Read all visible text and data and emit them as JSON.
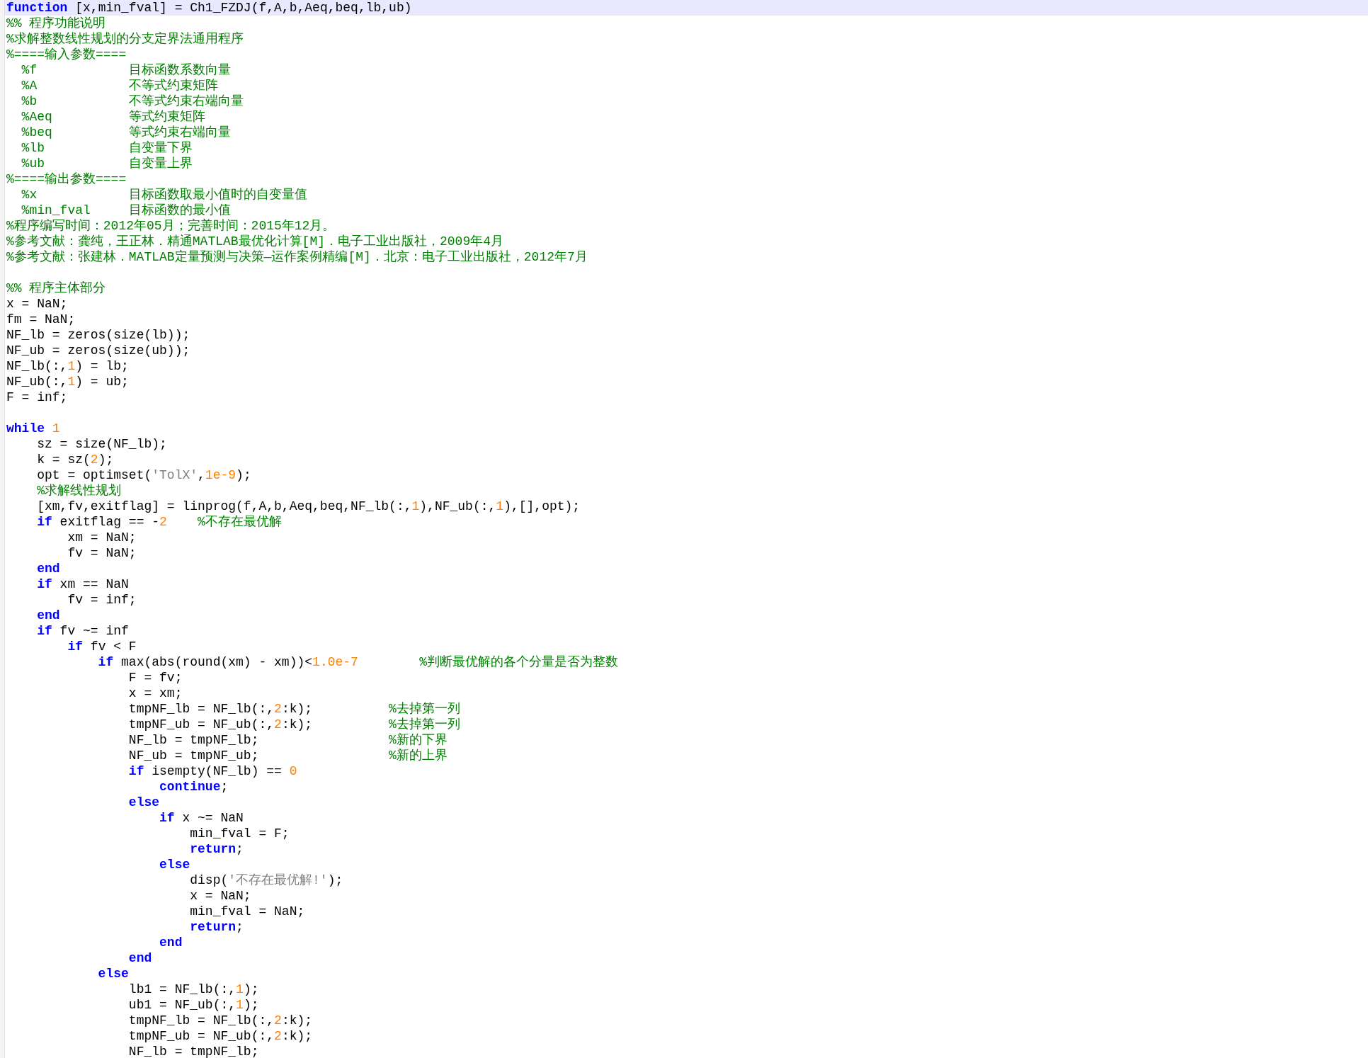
{
  "editor": {
    "lines": [
      {
        "current": true,
        "tokens": [
          {
            "kind": "keyword",
            "text": "function"
          },
          {
            "kind": "plain",
            "text": " [x,min_fval] = Ch1_FZDJ(f,A,b,Aeq,beq,lb,ub)"
          }
        ]
      },
      {
        "current": false,
        "tokens": [
          {
            "kind": "comment",
            "text": "%% 程序功能说明"
          }
        ]
      },
      {
        "current": false,
        "tokens": [
          {
            "kind": "comment",
            "text": "%求解整数线性规划的分支定界法通用程序"
          }
        ]
      },
      {
        "current": false,
        "tokens": [
          {
            "kind": "comment",
            "text": "%====输入参数===="
          }
        ]
      },
      {
        "current": false,
        "tokens": [
          {
            "kind": "comment",
            "text": "  %f            目标函数系数向量"
          }
        ]
      },
      {
        "current": false,
        "tokens": [
          {
            "kind": "comment",
            "text": "  %A            不等式约束矩阵"
          }
        ]
      },
      {
        "current": false,
        "tokens": [
          {
            "kind": "comment",
            "text": "  %b            不等式约束右端向量"
          }
        ]
      },
      {
        "current": false,
        "tokens": [
          {
            "kind": "comment",
            "text": "  %Aeq          等式约束矩阵"
          }
        ]
      },
      {
        "current": false,
        "tokens": [
          {
            "kind": "comment",
            "text": "  %beq          等式约束右端向量"
          }
        ]
      },
      {
        "current": false,
        "tokens": [
          {
            "kind": "comment",
            "text": "  %lb           自变量下界"
          }
        ]
      },
      {
        "current": false,
        "tokens": [
          {
            "kind": "comment",
            "text": "  %ub           自变量上界"
          }
        ]
      },
      {
        "current": false,
        "tokens": [
          {
            "kind": "comment",
            "text": "%====输出参数===="
          }
        ]
      },
      {
        "current": false,
        "tokens": [
          {
            "kind": "comment",
            "text": "  %x            目标函数取最小值时的自变量值"
          }
        ]
      },
      {
        "current": false,
        "tokens": [
          {
            "kind": "comment",
            "text": "  %min_fval     目标函数的最小值"
          }
        ]
      },
      {
        "current": false,
        "tokens": [
          {
            "kind": "comment",
            "text": "%程序编写时间：2012年05月；完善时间：2015年12月。"
          }
        ]
      },
      {
        "current": false,
        "tokens": [
          {
            "kind": "comment",
            "text": "%参考文献：龚纯，王正林．精通MATLAB最优化计算[M]．电子工业出版社，2009年4月"
          }
        ]
      },
      {
        "current": false,
        "tokens": [
          {
            "kind": "comment",
            "text": "%参考文献：张建林．MATLAB定量预测与决策—运作案例精编[M]．北京：电子工业出版社，2012年7月"
          }
        ]
      },
      {
        "current": false
      },
      {
        "current": false,
        "tokens": [
          {
            "kind": "comment",
            "text": "%% 程序主体部分"
          }
        ]
      },
      {
        "current": false,
        "tokens": [
          {
            "kind": "plain",
            "text": "x = NaN;"
          }
        ]
      },
      {
        "current": false,
        "tokens": [
          {
            "kind": "plain",
            "text": "fm = NaN;"
          }
        ]
      },
      {
        "current": false,
        "tokens": [
          {
            "kind": "plain",
            "text": "NF_lb = zeros(size(lb));"
          }
        ]
      },
      {
        "current": false,
        "tokens": [
          {
            "kind": "plain",
            "text": "NF_ub = zeros(size(ub));"
          }
        ]
      },
      {
        "current": false,
        "tokens": [
          {
            "kind": "plain",
            "text": "NF_lb(:,"
          },
          {
            "kind": "number",
            "text": "1"
          },
          {
            "kind": "plain",
            "text": ") = lb;"
          }
        ]
      },
      {
        "current": false,
        "tokens": [
          {
            "kind": "plain",
            "text": "NF_ub(:,"
          },
          {
            "kind": "number",
            "text": "1"
          },
          {
            "kind": "plain",
            "text": ") = ub;"
          }
        ]
      },
      {
        "current": false,
        "tokens": [
          {
            "kind": "plain",
            "text": "F = inf;"
          }
        ]
      },
      {
        "current": false
      },
      {
        "current": false,
        "tokens": [
          {
            "kind": "keyword",
            "text": "while"
          },
          {
            "kind": "number",
            "text": " 1"
          }
        ]
      },
      {
        "current": false,
        "tokens": [
          {
            "kind": "plain",
            "text": "    sz = size(NF_lb);"
          }
        ]
      },
      {
        "current": false,
        "tokens": [
          {
            "kind": "plain",
            "text": "    k = sz("
          },
          {
            "kind": "number",
            "text": "2"
          },
          {
            "kind": "plain",
            "text": ");"
          }
        ]
      },
      {
        "current": false,
        "tokens": [
          {
            "kind": "plain",
            "text": "    opt = optimset("
          },
          {
            "kind": "string",
            "text": "'TolX'"
          },
          {
            "kind": "plain",
            "text": ","
          },
          {
            "kind": "number",
            "text": "1e-9"
          },
          {
            "kind": "plain",
            "text": ");"
          }
        ]
      },
      {
        "current": false,
        "tokens": [
          {
            "kind": "comment",
            "text": "    %求解线性规划"
          }
        ]
      },
      {
        "current": false,
        "tokens": [
          {
            "kind": "plain",
            "text": "    [xm,fv,exitflag] = linprog(f,A,b,Aeq,beq,NF_lb(:,"
          },
          {
            "kind": "number",
            "text": "1"
          },
          {
            "kind": "plain",
            "text": "),NF_ub(:,"
          },
          {
            "kind": "number",
            "text": "1"
          },
          {
            "kind": "plain",
            "text": "),[],opt);"
          }
        ]
      },
      {
        "current": false,
        "tokens": [
          {
            "kind": "keyword",
            "text": "    if"
          },
          {
            "kind": "plain",
            "text": " exitflag == -"
          },
          {
            "kind": "number",
            "text": "2"
          },
          {
            "kind": "comment",
            "text": "    %不存在最优解"
          }
        ]
      },
      {
        "current": false,
        "tokens": [
          {
            "kind": "plain",
            "text": "        xm = NaN;"
          }
        ]
      },
      {
        "current": false,
        "tokens": [
          {
            "kind": "plain",
            "text": "        fv = NaN;"
          }
        ]
      },
      {
        "current": false,
        "tokens": [
          {
            "kind": "keyword",
            "text": "    end"
          }
        ]
      },
      {
        "current": false,
        "tokens": [
          {
            "kind": "keyword",
            "text": "    if"
          },
          {
            "kind": "plain",
            "text": " xm == NaN"
          }
        ]
      },
      {
        "current": false,
        "tokens": [
          {
            "kind": "plain",
            "text": "        fv = inf;"
          }
        ]
      },
      {
        "current": false,
        "tokens": [
          {
            "kind": "keyword",
            "text": "    end"
          }
        ]
      },
      {
        "current": false,
        "tokens": [
          {
            "kind": "keyword",
            "text": "    if"
          },
          {
            "kind": "plain",
            "text": " fv ~= inf"
          }
        ]
      },
      {
        "current": false,
        "tokens": [
          {
            "kind": "keyword",
            "text": "        if"
          },
          {
            "kind": "plain",
            "text": " fv < F"
          }
        ]
      },
      {
        "current": false,
        "tokens": [
          {
            "kind": "keyword",
            "text": "            if"
          },
          {
            "kind": "plain",
            "text": " max(abs(round(xm) - xm))<"
          },
          {
            "kind": "number",
            "text": "1.0e-7"
          },
          {
            "kind": "comment",
            "text": "        %判断最优解的各个分量是否为整数"
          }
        ]
      },
      {
        "current": false,
        "tokens": [
          {
            "kind": "plain",
            "text": "                F = fv;"
          }
        ]
      },
      {
        "current": false,
        "tokens": [
          {
            "kind": "plain",
            "text": "                x = xm;"
          }
        ]
      },
      {
        "current": false,
        "tokens": [
          {
            "kind": "plain",
            "text": "                tmpNF_lb = NF_lb(:,"
          },
          {
            "kind": "number",
            "text": "2"
          },
          {
            "kind": "plain",
            "text": ":k);"
          },
          {
            "kind": "comment",
            "text": "          %去掉第一列"
          }
        ]
      },
      {
        "current": false,
        "tokens": [
          {
            "kind": "plain",
            "text": "                tmpNF_ub = NF_ub(:,"
          },
          {
            "kind": "number",
            "text": "2"
          },
          {
            "kind": "plain",
            "text": ":k);"
          },
          {
            "kind": "comment",
            "text": "          %去掉第一列"
          }
        ]
      },
      {
        "current": false,
        "tokens": [
          {
            "kind": "plain",
            "text": "                NF_lb = tmpNF_lb;"
          },
          {
            "kind": "comment",
            "text": "                 %新的下界"
          }
        ]
      },
      {
        "current": false,
        "tokens": [
          {
            "kind": "plain",
            "text": "                NF_ub = tmpNF_ub;"
          },
          {
            "kind": "comment",
            "text": "                 %新的上界"
          }
        ]
      },
      {
        "current": false,
        "tokens": [
          {
            "kind": "keyword",
            "text": "                if"
          },
          {
            "kind": "plain",
            "text": " isempty(NF_lb) == "
          },
          {
            "kind": "number",
            "text": "0"
          }
        ]
      },
      {
        "current": false,
        "tokens": [
          {
            "kind": "keyword",
            "text": "                    continue"
          },
          {
            "kind": "plain",
            "text": ";"
          }
        ]
      },
      {
        "current": false,
        "tokens": [
          {
            "kind": "keyword",
            "text": "                else"
          }
        ]
      },
      {
        "current": false,
        "tokens": [
          {
            "kind": "keyword",
            "text": "                    if"
          },
          {
            "kind": "plain",
            "text": " x ~= NaN"
          }
        ]
      },
      {
        "current": false,
        "tokens": [
          {
            "kind": "plain",
            "text": "                        min_fval = F;"
          }
        ]
      },
      {
        "current": false,
        "tokens": [
          {
            "kind": "keyword",
            "text": "                        return"
          },
          {
            "kind": "plain",
            "text": ";"
          }
        ]
      },
      {
        "current": false,
        "tokens": [
          {
            "kind": "keyword",
            "text": "                    else"
          }
        ]
      },
      {
        "current": false,
        "tokens": [
          {
            "kind": "plain",
            "text": "                        disp("
          },
          {
            "kind": "string",
            "text": "'不存在最优解!'"
          },
          {
            "kind": "plain",
            "text": ");"
          }
        ]
      },
      {
        "current": false,
        "tokens": [
          {
            "kind": "plain",
            "text": "                        x = NaN;"
          }
        ]
      },
      {
        "current": false,
        "tokens": [
          {
            "kind": "plain",
            "text": "                        min_fval = NaN;"
          }
        ]
      },
      {
        "current": false,
        "tokens": [
          {
            "kind": "keyword",
            "text": "                        return"
          },
          {
            "kind": "plain",
            "text": ";"
          }
        ]
      },
      {
        "current": false,
        "tokens": [
          {
            "kind": "keyword",
            "text": "                    end"
          }
        ]
      },
      {
        "current": false,
        "tokens": [
          {
            "kind": "keyword",
            "text": "                end"
          }
        ]
      },
      {
        "current": false,
        "tokens": [
          {
            "kind": "keyword",
            "text": "            else"
          }
        ]
      },
      {
        "current": false,
        "tokens": [
          {
            "kind": "plain",
            "text": "                lb1 = NF_lb(:,"
          },
          {
            "kind": "number",
            "text": "1"
          },
          {
            "kind": "plain",
            "text": ");"
          }
        ]
      },
      {
        "current": false,
        "tokens": [
          {
            "kind": "plain",
            "text": "                ub1 = NF_ub(:,"
          },
          {
            "kind": "number",
            "text": "1"
          },
          {
            "kind": "plain",
            "text": ");"
          }
        ]
      },
      {
        "current": false,
        "tokens": [
          {
            "kind": "plain",
            "text": "                tmpNF_lb = NF_lb(:,"
          },
          {
            "kind": "number",
            "text": "2"
          },
          {
            "kind": "plain",
            "text": ":k);"
          }
        ]
      },
      {
        "current": false,
        "tokens": [
          {
            "kind": "plain",
            "text": "                tmpNF_ub = NF_ub(:,"
          },
          {
            "kind": "number",
            "text": "2"
          },
          {
            "kind": "plain",
            "text": ":k);"
          }
        ]
      },
      {
        "current": false,
        "tokens": [
          {
            "kind": "plain",
            "text": "                NF_lb = tmpNF_lb;"
          }
        ]
      }
    ]
  }
}
